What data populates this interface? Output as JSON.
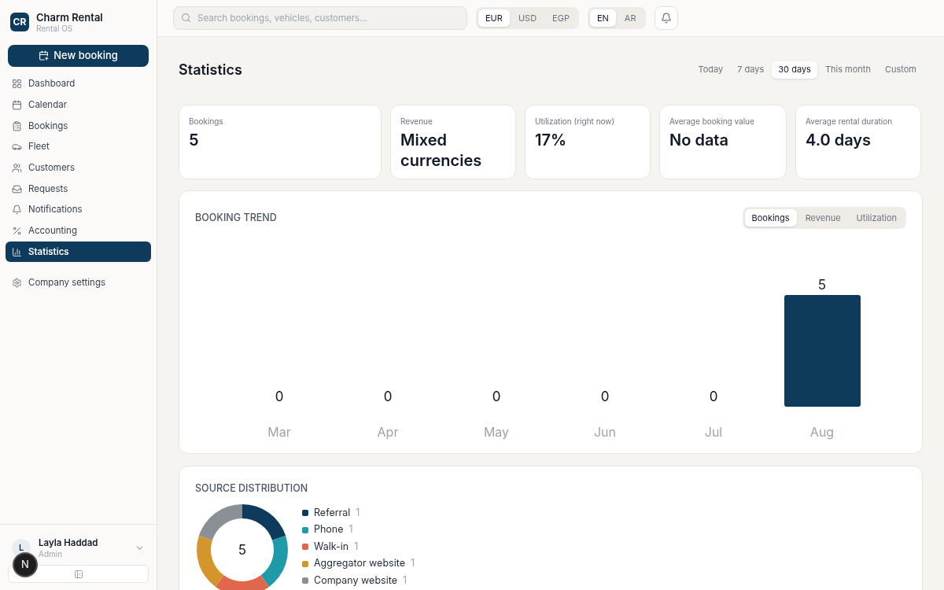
{
  "brand": {
    "initials": "CR",
    "name": "Charm Rental",
    "subtitle": "Rental OS"
  },
  "new_booking": "New booking",
  "nav": [
    {
      "label": "Dashboard",
      "selected": false
    },
    {
      "label": "Calendar",
      "selected": false
    },
    {
      "label": "Bookings",
      "selected": false
    },
    {
      "label": "Fleet",
      "selected": false
    },
    {
      "label": "Customers",
      "selected": false
    },
    {
      "label": "Requests",
      "selected": false
    },
    {
      "label": "Notifications",
      "selected": false
    },
    {
      "label": "Accounting",
      "selected": false
    },
    {
      "label": "Statistics",
      "selected": true
    }
  ],
  "settings_nav": {
    "label": "Company settings",
    "selected": false
  },
  "user": {
    "initial": "L",
    "name": "Layla Haddad",
    "role": "Admin"
  },
  "dev_badge": "N",
  "search": {
    "placeholder": "Search bookings, vehicles, customers..."
  },
  "currencies": [
    {
      "label": "EUR",
      "selected": true
    },
    {
      "label": "USD",
      "selected": false
    },
    {
      "label": "EGP",
      "selected": false
    }
  ],
  "languages": [
    {
      "label": "EN",
      "selected": true
    },
    {
      "label": "AR",
      "selected": false
    }
  ],
  "page_title": "Statistics",
  "ranges": [
    {
      "label": "Today",
      "selected": false
    },
    {
      "label": "7 days",
      "selected": false
    },
    {
      "label": "30 days",
      "selected": true
    },
    {
      "label": "This month",
      "selected": false
    },
    {
      "label": "Custom",
      "selected": false
    }
  ],
  "kpis": [
    {
      "label": "Bookings",
      "value": "5"
    },
    {
      "label": "Revenue",
      "value": "Mixed currencies"
    },
    {
      "label": "Utilization (right now)",
      "value": "17%"
    },
    {
      "label": "Average booking value",
      "value": "No data"
    },
    {
      "label": "Average rental duration",
      "value": "4.0 days"
    }
  ],
  "booking_trend": {
    "title": "BOOKING TREND",
    "tabs": [
      {
        "label": "Bookings",
        "selected": true
      },
      {
        "label": "Revenue",
        "selected": false
      },
      {
        "label": "Utilization",
        "selected": false
      }
    ],
    "chart_data": {
      "type": "bar",
      "categories": [
        "Mar",
        "Apr",
        "May",
        "Jun",
        "Jul",
        "Aug"
      ],
      "series": [
        {
          "color": "#0e3a5c",
          "values": [
            0,
            0,
            0,
            0,
            0,
            5
          ]
        }
      ],
      "data_labels": true
    }
  },
  "source_distribution": {
    "title": "SOURCE DISTRIBUTION",
    "total": "5",
    "chart_data": {
      "type": "donut",
      "categories": [
        "Referral",
        "Phone",
        "Walk-in",
        "Aggregator website",
        "Company website"
      ],
      "values": [
        20,
        20,
        20,
        20,
        20
      ]
    },
    "legend": [
      {
        "count": "1",
        "color": "#0e3a5c"
      },
      {
        "count": "1",
        "color": "#1e9aa8"
      },
      {
        "count": "1",
        "color": "#e0674c"
      },
      {
        "count": "1",
        "color": "#d4952c"
      },
      {
        "count": "1",
        "color": "#8a9096"
      }
    ]
  }
}
